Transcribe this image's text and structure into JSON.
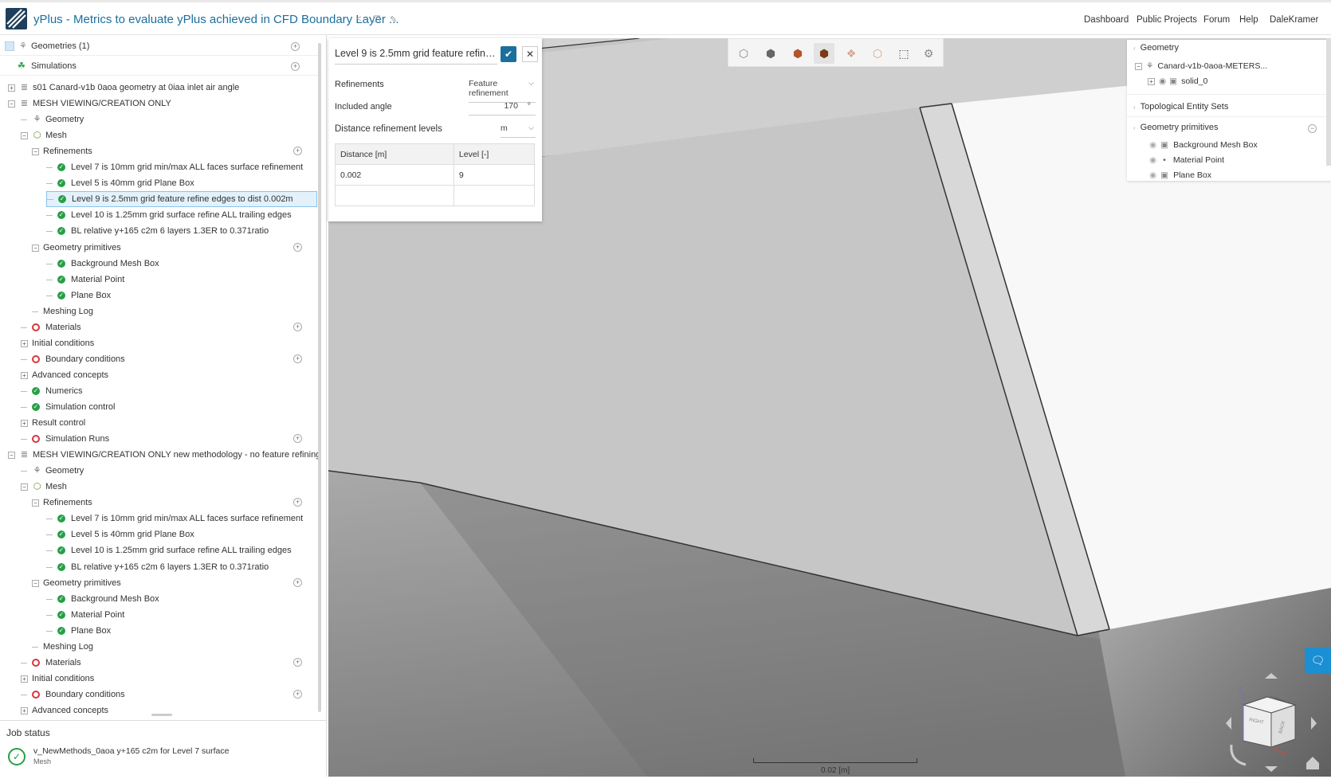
{
  "header": {
    "title": "yPlus - Metrics to evaluate yPlus achieved in CFD Boundary Layer ...",
    "icons": [
      "share-icon",
      "copy-icon",
      "edit-icon"
    ],
    "nav": [
      "Dashboard",
      "Public Projects",
      "Forum",
      "Help",
      "DaleKramer"
    ]
  },
  "tree": {
    "geometries_label": "Geometries (1)",
    "simulations_label": "Simulations",
    "rows": [
      {
        "depth": 0,
        "toggle": "+",
        "icon": "sim",
        "label": "s01 Canard-v1b 0aoa geometry at 0iaa inlet air angle"
      },
      {
        "depth": 0,
        "toggle": "−",
        "icon": "sim",
        "label": "MESH VIEWING/CREATION ONLY"
      },
      {
        "depth": 1,
        "toggle": "",
        "icon": "geometry",
        "label": "Geometry"
      },
      {
        "depth": 1,
        "toggle": "−",
        "icon": "mesh",
        "label": "Mesh"
      },
      {
        "depth": 2,
        "toggle": "−",
        "icon": "",
        "label": "Refinements",
        "plus": true
      },
      {
        "depth": 3,
        "toggle": "",
        "icon": "ok",
        "label": "Level 7 is 10mm grid min/max ALL faces surface refinement"
      },
      {
        "depth": 3,
        "toggle": "",
        "icon": "ok",
        "label": "Level 5 is 40mm grid Plane Box"
      },
      {
        "depth": 3,
        "toggle": "",
        "icon": "ok",
        "label": "Level 9 is 2.5mm grid feature refine edges to dist 0.002m",
        "selected": true
      },
      {
        "depth": 3,
        "toggle": "",
        "icon": "ok",
        "label": "Level 10 is 1.25mm grid surface refine ALL trailing edges"
      },
      {
        "depth": 3,
        "toggle": "",
        "icon": "ok",
        "label": "BL relative y+165 c2m 6 layers 1.3ER to 0.371ratio"
      },
      {
        "depth": 2,
        "toggle": "−",
        "icon": "",
        "label": "Geometry primitives",
        "plus": true
      },
      {
        "depth": 3,
        "toggle": "",
        "icon": "ok",
        "label": "Background Mesh Box"
      },
      {
        "depth": 3,
        "toggle": "",
        "icon": "ok",
        "label": "Material Point"
      },
      {
        "depth": 3,
        "toggle": "",
        "icon": "ok",
        "label": "Plane Box"
      },
      {
        "depth": 2,
        "toggle": "",
        "icon": "",
        "label": "Meshing Log"
      },
      {
        "depth": 1,
        "toggle": "",
        "icon": "err",
        "label": "Materials",
        "plus": true
      },
      {
        "depth": 1,
        "toggle": "+",
        "icon": "",
        "label": "Initial conditions"
      },
      {
        "depth": 1,
        "toggle": "",
        "icon": "err",
        "label": "Boundary conditions",
        "plus": true
      },
      {
        "depth": 1,
        "toggle": "+",
        "icon": "",
        "label": "Advanced concepts"
      },
      {
        "depth": 1,
        "toggle": "",
        "icon": "ok",
        "label": "Numerics"
      },
      {
        "depth": 1,
        "toggle": "",
        "icon": "ok",
        "label": "Simulation control"
      },
      {
        "depth": 1,
        "toggle": "+",
        "icon": "",
        "label": "Result control"
      },
      {
        "depth": 1,
        "toggle": "",
        "icon": "err",
        "label": "Simulation Runs",
        "plus": true
      },
      {
        "depth": 0,
        "toggle": "−",
        "icon": "sim",
        "label": "MESH VIEWING/CREATION ONLY new methodology - no feature refining"
      },
      {
        "depth": 1,
        "toggle": "",
        "icon": "geometry",
        "label": "Geometry"
      },
      {
        "depth": 1,
        "toggle": "−",
        "icon": "mesh",
        "label": "Mesh"
      },
      {
        "depth": 2,
        "toggle": "−",
        "icon": "",
        "label": "Refinements",
        "plus": true
      },
      {
        "depth": 3,
        "toggle": "",
        "icon": "ok",
        "label": "Level 7 is 10mm grid min/max ALL faces surface refinement"
      },
      {
        "depth": 3,
        "toggle": "",
        "icon": "ok",
        "label": "Level 5 is 40mm grid Plane Box"
      },
      {
        "depth": 3,
        "toggle": "",
        "icon": "ok",
        "label": "Level 10 is 1.25mm grid surface refine ALL trailing edges"
      },
      {
        "depth": 3,
        "toggle": "",
        "icon": "ok",
        "label": "BL relative y+165 c2m 6 layers 1.3ER to 0.371ratio"
      },
      {
        "depth": 2,
        "toggle": "−",
        "icon": "",
        "label": "Geometry primitives",
        "plus": true
      },
      {
        "depth": 3,
        "toggle": "",
        "icon": "ok",
        "label": "Background Mesh Box"
      },
      {
        "depth": 3,
        "toggle": "",
        "icon": "ok",
        "label": "Material Point"
      },
      {
        "depth": 3,
        "toggle": "",
        "icon": "ok",
        "label": "Plane Box"
      },
      {
        "depth": 2,
        "toggle": "",
        "icon": "",
        "label": "Meshing Log"
      },
      {
        "depth": 1,
        "toggle": "",
        "icon": "err",
        "label": "Materials",
        "plus": true
      },
      {
        "depth": 1,
        "toggle": "+",
        "icon": "",
        "label": "Initial conditions"
      },
      {
        "depth": 1,
        "toggle": "",
        "icon": "err",
        "label": "Boundary conditions",
        "plus": true
      },
      {
        "depth": 1,
        "toggle": "+",
        "icon": "",
        "label": "Advanced concepts"
      }
    ]
  },
  "job_status": {
    "title": "Job status",
    "job_name": "v_NewMethods_0aoa y+165 c2m for Level 7 surface",
    "job_type": "Mesh"
  },
  "dialog": {
    "title": "Level 9 is 2.5mm grid feature refine e...",
    "refinements_label": "Refinements",
    "refinements_value": "Feature refinement",
    "angle_label": "Included angle",
    "angle_value": "170",
    "angle_unit": "°",
    "distance_label": "Distance refinement levels",
    "distance_unit": "m",
    "table_headers": [
      "Distance [m]",
      "Level [-]"
    ],
    "table_rows": [
      [
        "0.002",
        "9"
      ],
      [
        "",
        ""
      ]
    ]
  },
  "view_toolbar": {
    "buttons": [
      {
        "icon": "cube-wireframe-icon",
        "active": false
      },
      {
        "icon": "cube-solid-icon",
        "active": false
      },
      {
        "icon": "cube-orange-icon",
        "active": false
      },
      {
        "icon": "cube-edges-icon",
        "active": true
      },
      {
        "icon": "explode-icon",
        "active": false
      },
      {
        "icon": "cube-outline-orange-icon",
        "active": false
      },
      {
        "icon": "box-select-icon",
        "active": false
      },
      {
        "icon": "settings-icon",
        "active": false
      }
    ]
  },
  "geometry_panel": {
    "geometry_title": "Geometry",
    "geometry_item": "Canard-v1b-0aoa-METERS...",
    "solid_item": "solid_0",
    "topological_title": "Topological Entity Sets",
    "primitives_title": "Geometry primitives",
    "primitives": [
      "Background Mesh Box",
      "Material Point",
      "Plane Box"
    ]
  },
  "scale": {
    "label": "0.02 [m]"
  },
  "nav_cube": {
    "face_front": "RIGHT",
    "face_side": "BACK",
    "axis_z": "Z",
    "axis_x": "X"
  }
}
